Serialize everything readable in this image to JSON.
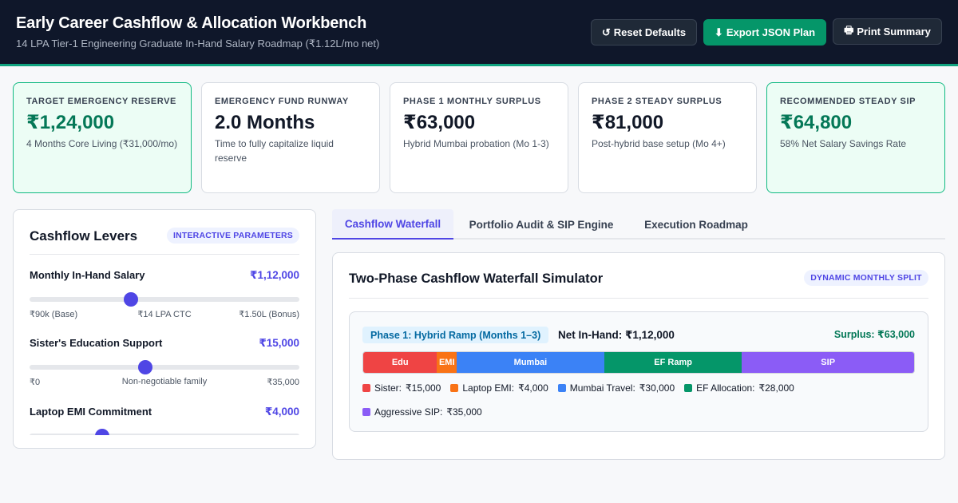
{
  "header": {
    "title": "Early Career Cashflow & Allocation Workbench",
    "subtitle": "14 LPA Tier-1 Engineering Graduate In-Hand Salary Roadmap (₹1.12L/mo net)",
    "buttons": [
      {
        "icon": "reset-icon",
        "glyph": "↺",
        "label": "Reset Defaults"
      },
      {
        "icon": "download-icon",
        "glyph": "⬇",
        "label": "Export JSON Plan"
      },
      {
        "icon": "printer-icon",
        "glyph": "🖶",
        "label": "Print Summary"
      }
    ]
  },
  "cards": [
    {
      "label": "Target Emergency Reserve",
      "value": "₹1,24,000",
      "desc": "4 Months Core Living (₹31,000/mo)"
    },
    {
      "label": "Emergency Fund Runway",
      "value": "2.0 Months",
      "desc": "Time to fully capitalize liquid reserve"
    },
    {
      "label": "Phase 1 Monthly Surplus",
      "value": "₹63,000",
      "desc": "Hybrid Mumbai probation (Mo 1-3)"
    },
    {
      "label": "Phase 2 Steady Surplus",
      "value": "₹81,000",
      "desc": "Post-hybrid base setup (Mo 4+)"
    },
    {
      "label": "Recommended Steady SIP",
      "value": "₹64,800",
      "desc": "58% Net Salary Savings Rate"
    }
  ],
  "levers": {
    "title": "Cashflow Levers",
    "badge": "INTERACTIVE PARAMETERS",
    "items": [
      {
        "label": "Monthly In-Hand Salary",
        "value": "₹1,12,000",
        "level": 0.375,
        "ticks": [
          "₹90k (Base)",
          "₹14 LPA CTC",
          "₹1.50L (Bonus)"
        ]
      },
      {
        "label": "Sister's Education Support",
        "value": "₹15,000",
        "level": 0.43,
        "ticks": [
          "₹0",
          "Non-negotiable family",
          "₹35,000"
        ]
      },
      {
        "label": "Laptop EMI Commitment",
        "value": "₹4,000",
        "level": 0.27,
        "ticks": [
          "",
          "",
          ""
        ]
      }
    ]
  },
  "tabs": [
    "Cashflow Waterfall",
    "Portfolio Audit & SIP Engine",
    "Execution Roadmap"
  ],
  "simulator": {
    "title": "Two-Phase Cashflow Waterfall Simulator",
    "badge": "DYNAMIC MONTHLY SPLIT",
    "phase1": {
      "badge": "Phase 1: Hybrid Ramp (Months 1–3)",
      "net": "Net In-Hand: ₹1,12,000",
      "surplus": "Surplus: ₹63,000",
      "segments": [
        {
          "short": "Edu",
          "name": "Sister:",
          "display": "₹15,000",
          "amount": 15000,
          "color": "#ef4444"
        },
        {
          "short": "EMI",
          "name": "Laptop EMI:",
          "display": "₹4,000",
          "amount": 4000,
          "color": "#f97316"
        },
        {
          "short": "Mumbai",
          "name": "Mumbai Travel:",
          "display": "₹30,000",
          "amount": 30000,
          "color": "#3b82f6"
        },
        {
          "short": "EF Ramp",
          "name": "EF Allocation:",
          "display": "₹28,000",
          "amount": 28000,
          "color": "#059669"
        },
        {
          "short": "SIP",
          "name": "Aggressive SIP:",
          "display": "₹35,000",
          "amount": 35000,
          "color": "#8b5cf6"
        }
      ]
    }
  }
}
